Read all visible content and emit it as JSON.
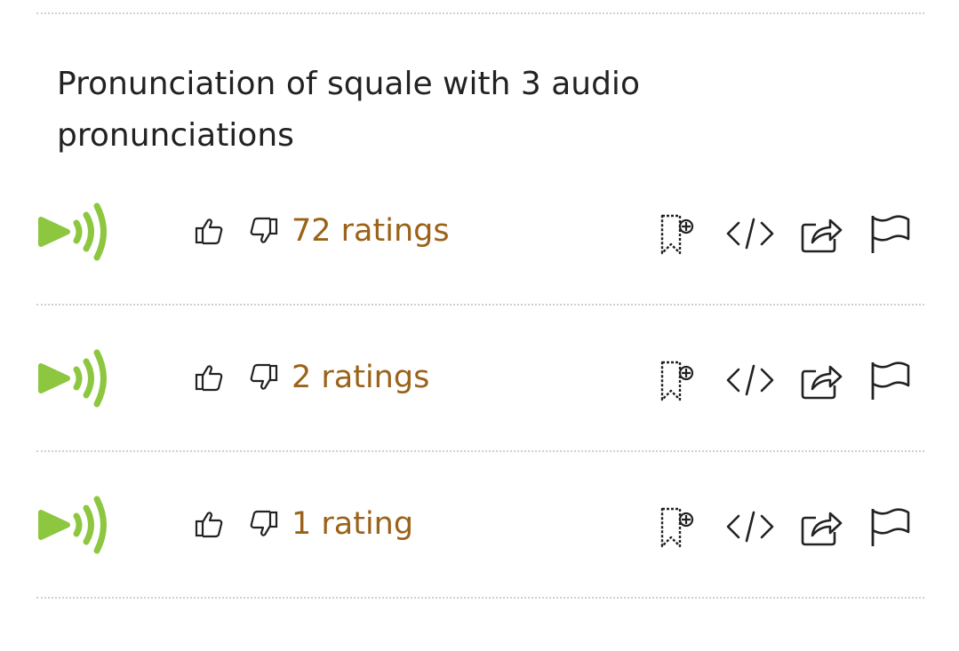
{
  "title": "Pronunciation of squale with 3 audio pronunciations",
  "colors": {
    "play": "#8dc63f",
    "ratings": "#9b6219",
    "icons": "#222222",
    "divider": "#cfcfcf"
  },
  "pronunciations": [
    {
      "ratings_label": "72 ratings"
    },
    {
      "ratings_label": "2 ratings"
    },
    {
      "ratings_label": "1 rating"
    }
  ],
  "icons": {
    "play": "play-audio-icon",
    "thumb_up": "thumbs-up-icon",
    "thumb_down": "thumbs-down-icon",
    "favorite": "bookmark-add-icon",
    "embed": "embed-code-icon",
    "share": "share-icon",
    "flag": "flag-icon"
  }
}
